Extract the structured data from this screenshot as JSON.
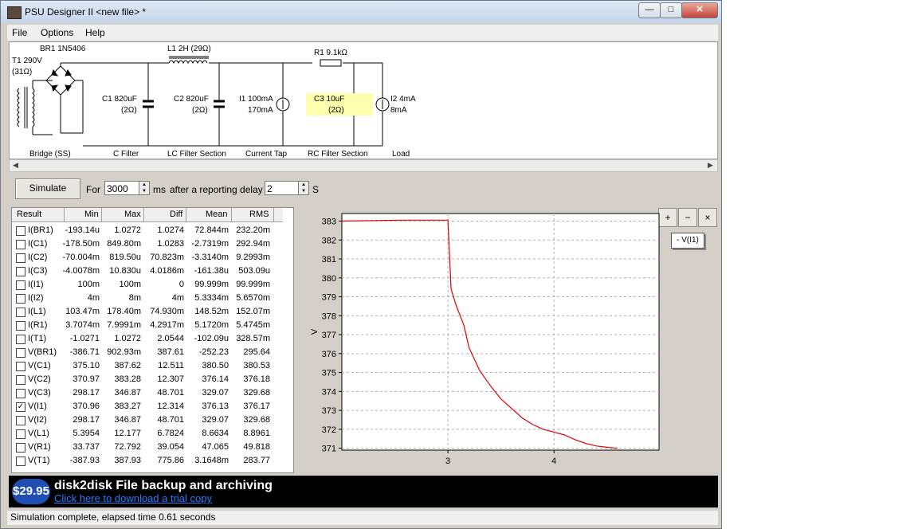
{
  "window": {
    "title": "PSU Designer II  <new file> *",
    "minimize": "—",
    "maximize": "□",
    "close": "✕"
  },
  "menu": [
    "File",
    "Options",
    "Help"
  ],
  "schematic": {
    "br1": "BR1 1N5406",
    "t1": "T1 290V",
    "t1_ohm": "(31Ω)",
    "l1": "L1 2H (29Ω)",
    "r1": "R1 9.1kΩ",
    "c1": "C1 820uF",
    "c1_esr": "(2Ω)",
    "c2": "C2 820uF",
    "c2_esr": "(2Ω)",
    "i1": "I1 100mA",
    "i1_b": "170mA",
    "c3": "C3 10uF",
    "c3_esr": "(2Ω)",
    "i2": "I2 4mA",
    "i2_b": "8mA",
    "sections": [
      "Bridge (SS)",
      "C Filter",
      "LC Filter Section",
      "Current Tap",
      "RC Filter Section",
      "Load"
    ]
  },
  "controls": {
    "simulate": "Simulate",
    "for": "For",
    "duration": "3000",
    "ms": "ms",
    "after": "after a reporting delay of",
    "delay": "2",
    "unit": "S"
  },
  "results": {
    "headers": [
      "Result",
      "Min",
      "Max",
      "Diff",
      "Mean",
      "RMS"
    ],
    "rows": [
      {
        "name": "I(BR1)",
        "min": "-193.14u",
        "max": "1.0272",
        "diff": "1.0274",
        "mean": "72.844m",
        "rms": "232.20m",
        "checked": false
      },
      {
        "name": "I(C1)",
        "min": "-178.50m",
        "max": "849.80m",
        "diff": "1.0283",
        "mean": "-2.7319m",
        "rms": "292.94m",
        "checked": false
      },
      {
        "name": "I(C2)",
        "min": "-70.004m",
        "max": "819.50u",
        "diff": "70.823m",
        "mean": "-3.3140m",
        "rms": "9.2993m",
        "checked": false
      },
      {
        "name": "I(C3)",
        "min": "-4.0078m",
        "max": "10.830u",
        "diff": "4.0186m",
        "mean": "-161.38u",
        "rms": "503.09u",
        "checked": false
      },
      {
        "name": "I(I1)",
        "min": "100m",
        "max": "100m",
        "diff": "0",
        "mean": "99.999m",
        "rms": "99.999m",
        "checked": false
      },
      {
        "name": "I(I2)",
        "min": "4m",
        "max": "8m",
        "diff": "4m",
        "mean": "5.3334m",
        "rms": "5.6570m",
        "checked": false
      },
      {
        "name": "I(L1)",
        "min": "103.47m",
        "max": "178.40m",
        "diff": "74.930m",
        "mean": "148.52m",
        "rms": "152.07m",
        "checked": false
      },
      {
        "name": "I(R1)",
        "min": "3.7074m",
        "max": "7.9991m",
        "diff": "4.2917m",
        "mean": "5.1720m",
        "rms": "5.4745m",
        "checked": false
      },
      {
        "name": "I(T1)",
        "min": "-1.0271",
        "max": "1.0272",
        "diff": "2.0544",
        "mean": "-102.09u",
        "rms": "328.57m",
        "checked": false
      },
      {
        "name": "V(BR1)",
        "min": "-386.71",
        "max": "902.93m",
        "diff": "387.61",
        "mean": "-252.23",
        "rms": "295.64",
        "checked": false
      },
      {
        "name": "V(C1)",
        "min": "375.10",
        "max": "387.62",
        "diff": "12.511",
        "mean": "380.50",
        "rms": "380.53",
        "checked": false
      },
      {
        "name": "V(C2)",
        "min": "370.97",
        "max": "383.28",
        "diff": "12.307",
        "mean": "376.14",
        "rms": "376.18",
        "checked": false
      },
      {
        "name": "V(C3)",
        "min": "298.17",
        "max": "346.87",
        "diff": "48.701",
        "mean": "329.07",
        "rms": "329.68",
        "checked": false
      },
      {
        "name": "V(I1)",
        "min": "370.96",
        "max": "383.27",
        "diff": "12.314",
        "mean": "376.13",
        "rms": "376.17",
        "checked": true
      },
      {
        "name": "V(I2)",
        "min": "298.17",
        "max": "346.87",
        "diff": "48.701",
        "mean": "329.07",
        "rms": "329.68",
        "checked": false
      },
      {
        "name": "V(L1)",
        "min": "5.3954",
        "max": "12.177",
        "diff": "6.7824",
        "mean": "8.6634",
        "rms": "8.8961",
        "checked": false
      },
      {
        "name": "V(R1)",
        "min": "33.737",
        "max": "72.792",
        "diff": "39.054",
        "mean": "47.065",
        "rms": "49.818",
        "checked": false
      },
      {
        "name": "V(T1)",
        "min": "-387.93",
        "max": "387.93",
        "diff": "775.86",
        "mean": "3.1648m",
        "rms": "283.77",
        "checked": false
      }
    ]
  },
  "chart_data": {
    "type": "line",
    "title": "",
    "xlabel": "",
    "ylabel": "V",
    "xlim": [
      2.0,
      4.99
    ],
    "ylim": [
      370.9,
      383.4
    ],
    "xticks": [
      3,
      4
    ],
    "yticks": [
      371,
      372,
      373,
      374,
      375,
      376,
      377,
      378,
      379,
      380,
      381,
      382,
      383
    ],
    "grid": true,
    "legend_position": "top-right",
    "series": [
      {
        "name": "V(I1)",
        "color": "#e00000",
        "x": [
          2.0,
          2.55,
          2.999,
          3.0,
          3.03,
          3.08,
          3.15,
          3.2,
          3.3,
          3.4,
          3.5,
          3.6,
          3.7,
          3.8,
          3.9,
          4.0,
          4.1,
          4.2,
          4.3,
          4.4,
          4.5,
          4.6
        ],
        "y": [
          383.0,
          383.05,
          383.05,
          383.0,
          379.4,
          378.5,
          377.5,
          376.3,
          375.1,
          374.3,
          373.6,
          373.1,
          372.6,
          372.25,
          372.0,
          371.85,
          371.7,
          371.45,
          371.25,
          371.12,
          371.05,
          371.0
        ]
      }
    ]
  },
  "zoom": {
    "zoom_in": "+",
    "zoom_out": "−",
    "zoom_reset": "×"
  },
  "legend_label": "- V(I1)",
  "banner": {
    "badge": "$29.95",
    "title": "disk2disk File backup and archiving",
    "link": "Click here to download a trial copy"
  },
  "status": "Simulation complete, elapsed time 0.61 seconds"
}
